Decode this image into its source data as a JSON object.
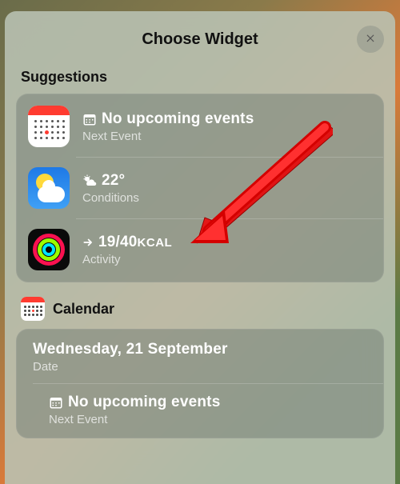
{
  "header": {
    "title": "Choose Widget"
  },
  "sections": {
    "suggestions": {
      "label": "Suggestions",
      "items": [
        {
          "icon": "calendar",
          "title": "No upcoming events",
          "subtitle": "Next Event",
          "glyph": "calendar-grid"
        },
        {
          "icon": "weather",
          "title": "22°",
          "subtitle": "Conditions",
          "glyph": "sun-cloud"
        },
        {
          "icon": "activity",
          "title_prefix": "→ ",
          "title_value": "19/40",
          "title_unit": "KCAL",
          "subtitle": "Activity",
          "glyph": "arrow-right"
        }
      ]
    },
    "calendar": {
      "label": "Calendar",
      "items": [
        {
          "title": "Wednesday, 21 September",
          "subtitle": "Date"
        },
        {
          "title": "No upcoming events",
          "subtitle": "Next Event",
          "glyph": "calendar-grid"
        }
      ]
    }
  }
}
